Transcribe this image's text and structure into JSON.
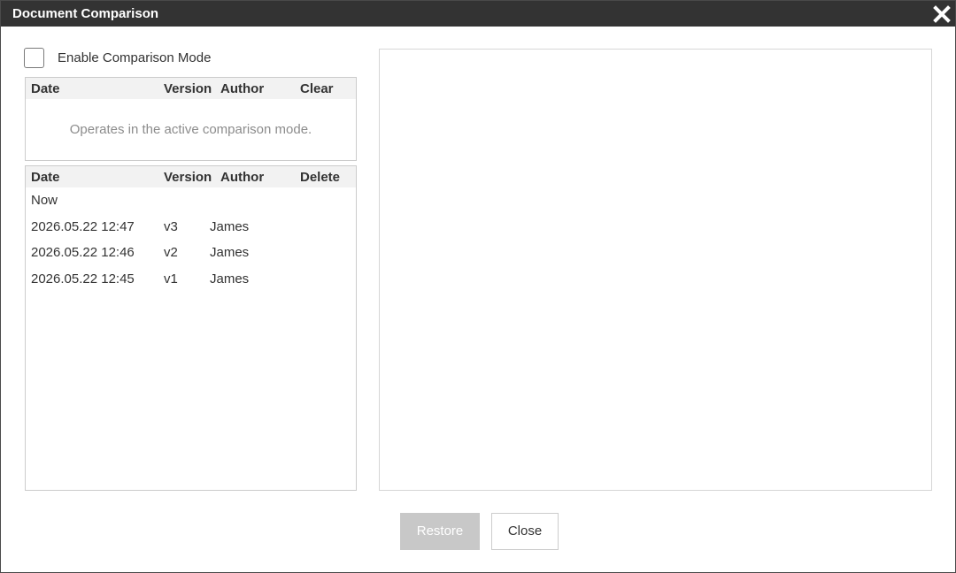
{
  "dialog": {
    "title": "Document Comparison"
  },
  "comparison_mode": {
    "label": "Enable Comparison Mode",
    "checked": false
  },
  "compare_table": {
    "headers": [
      "Date",
      "Version",
      "Author",
      "Clear"
    ],
    "empty_message": "Operates in the active comparison mode."
  },
  "history_table": {
    "headers": [
      "Date",
      "Version",
      "Author",
      "Delete"
    ],
    "rows": [
      {
        "date": "Now",
        "version": "",
        "author": ""
      },
      {
        "date": "2026.05.22 12:47",
        "version": "v3",
        "author": "James"
      },
      {
        "date": "2026.05.22 12:46",
        "version": "v2",
        "author": "James"
      },
      {
        "date": "2026.05.22 12:45",
        "version": "v1",
        "author": "James"
      }
    ]
  },
  "buttons": {
    "restore": "Restore",
    "close": "Close"
  },
  "colors": {
    "titlebar": "#333333",
    "restore_disabled": "#c8c8c8"
  }
}
